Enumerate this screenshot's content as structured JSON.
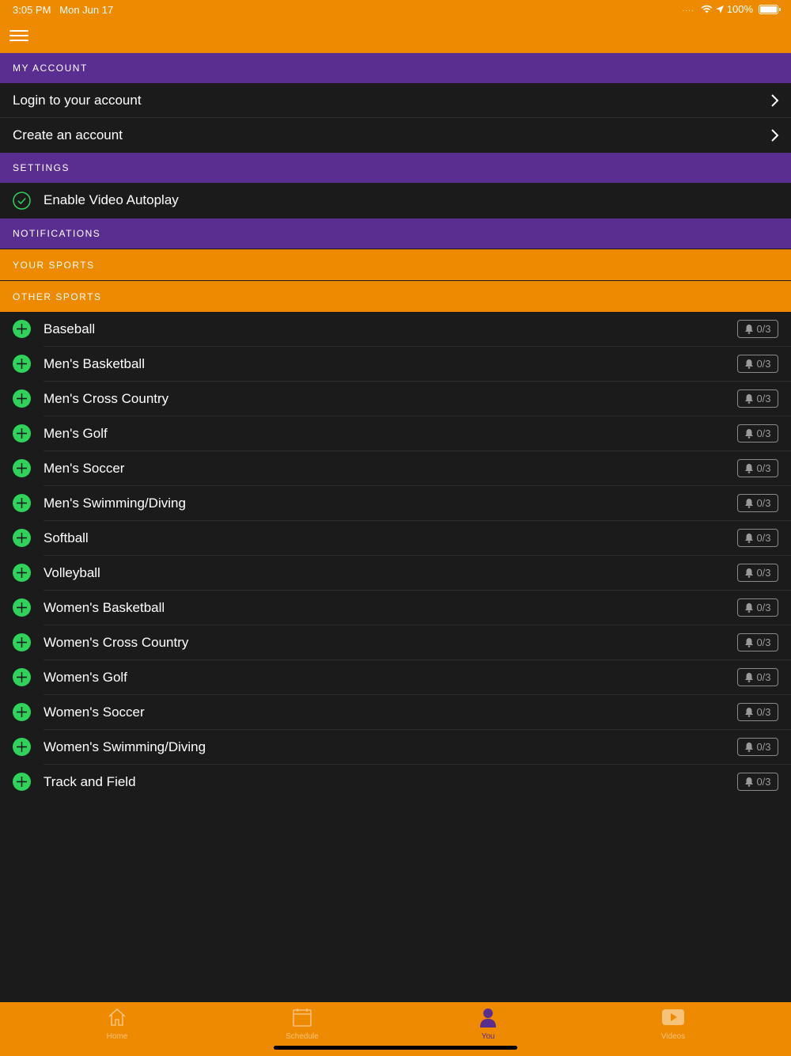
{
  "status_bar": {
    "time": "3:05 PM",
    "date": "Mon Jun 17",
    "signal": "....",
    "battery": "100%"
  },
  "colors": {
    "accent_orange": "#ee8a00",
    "purple": "#5a2d91",
    "background": "#1b1b1b",
    "plus_green": "#2fd35a"
  },
  "sections": {
    "my_account": "MY ACCOUNT",
    "settings": "SETTINGS",
    "notifications": "NOTIFICATIONS",
    "your_sports": "YOUR SPORTS",
    "other_sports": "OTHER SPORTS"
  },
  "account": {
    "login": "Login to your account",
    "create": "Create an account"
  },
  "settings": {
    "autoplay": "Enable Video Autoplay"
  },
  "sports": [
    {
      "name": "Baseball",
      "badge": "0/3"
    },
    {
      "name": "Men's Basketball",
      "badge": "0/3"
    },
    {
      "name": "Men's Cross Country",
      "badge": "0/3"
    },
    {
      "name": "Men's Golf",
      "badge": "0/3"
    },
    {
      "name": "Men's Soccer",
      "badge": "0/3"
    },
    {
      "name": "Men's Swimming/Diving",
      "badge": "0/3"
    },
    {
      "name": "Softball",
      "badge": "0/3"
    },
    {
      "name": "Volleyball",
      "badge": "0/3"
    },
    {
      "name": "Women's Basketball",
      "badge": "0/3"
    },
    {
      "name": "Women's Cross Country",
      "badge": "0/3"
    },
    {
      "name": "Women's Golf",
      "badge": "0/3"
    },
    {
      "name": "Women's Soccer",
      "badge": "0/3"
    },
    {
      "name": "Women's Swimming/Diving",
      "badge": "0/3"
    },
    {
      "name": "Track and Field",
      "badge": "0/3"
    }
  ],
  "tabs": [
    {
      "label": "Home",
      "icon": "home-icon",
      "active": false
    },
    {
      "label": "Schedule",
      "icon": "calendar-icon",
      "active": false
    },
    {
      "label": "You",
      "icon": "person-icon",
      "active": true
    },
    {
      "label": "Videos",
      "icon": "play-video-icon",
      "active": false
    }
  ]
}
